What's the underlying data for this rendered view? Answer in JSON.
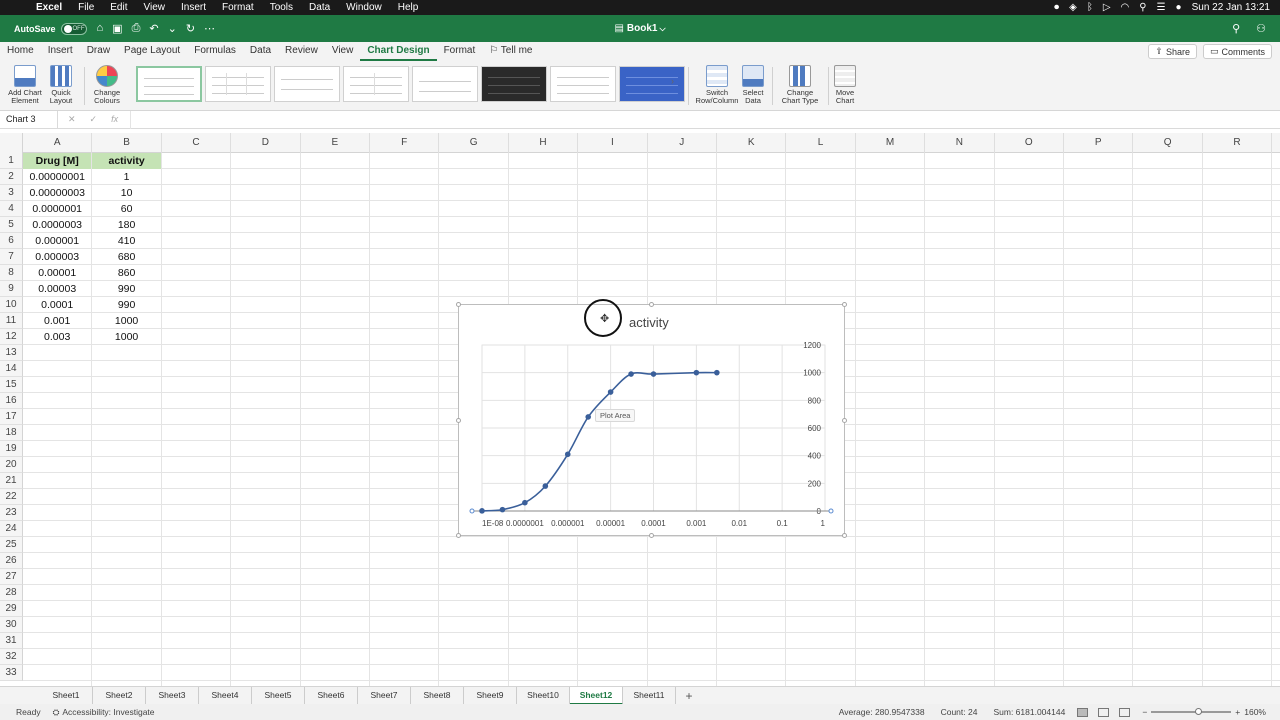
{
  "menubar": {
    "app": "Excel",
    "items": [
      "File",
      "Edit",
      "View",
      "Insert",
      "Format",
      "Tools",
      "Data",
      "Window",
      "Help"
    ],
    "clock": "Sun 22 Jan  13:21"
  },
  "titlebar": {
    "autosave": "AutoSave",
    "autosave_state": "OFF",
    "doc_title": "Book1",
    "doc_chevron": "⌵"
  },
  "ribbon_tabs": [
    "Home",
    "Insert",
    "Draw",
    "Page Layout",
    "Formulas",
    "Data",
    "Review",
    "View",
    "Chart Design",
    "Format",
    "Tell me"
  ],
  "ribbon_buttons": {
    "share": "Share",
    "comments": "Comments",
    "add_chart_element": [
      "Add Chart",
      "Element"
    ],
    "quick_layout": [
      "Quick",
      "Layout"
    ],
    "change_colours": [
      "Change",
      "Colours"
    ],
    "switch_row_col": [
      "Switch",
      "Row/Column"
    ],
    "select_data": [
      "Select",
      "Data"
    ],
    "change_chart_type": [
      "Change",
      "Chart Type"
    ],
    "move_chart": [
      "Move",
      "Chart"
    ]
  },
  "formula_bar": {
    "name_box": "Chart 3",
    "fx": "fx"
  },
  "columns": [
    "A",
    "B",
    "C",
    "D",
    "E",
    "F",
    "G",
    "H",
    "I",
    "J",
    "K",
    "L",
    "M",
    "N",
    "O",
    "P",
    "Q",
    "R"
  ],
  "rows": [
    "1",
    "2",
    "3",
    "4",
    "5",
    "6",
    "7",
    "8",
    "9",
    "10",
    "11",
    "12",
    "13",
    "14",
    "15",
    "16",
    "17",
    "18",
    "19",
    "20",
    "21",
    "22",
    "23",
    "24",
    "25",
    "26",
    "27",
    "28",
    "29",
    "30",
    "31",
    "32",
    "33"
  ],
  "sheet": {
    "headers": [
      "Drug [M]",
      "activity"
    ],
    "data": [
      [
        "0.00000001",
        "1"
      ],
      [
        "0.00000003",
        "10"
      ],
      [
        "0.0000001",
        "60"
      ],
      [
        "0.0000003",
        "180"
      ],
      [
        "0.000001",
        "410"
      ],
      [
        "0.000003",
        "680"
      ],
      [
        "0.00001",
        "860"
      ],
      [
        "0.00003",
        "990"
      ],
      [
        "0.0001",
        "990"
      ],
      [
        "0.001",
        "1000"
      ],
      [
        "0.003",
        "1000"
      ]
    ]
  },
  "chart_data": {
    "type": "scatter",
    "title": "activity",
    "x_scale": "log",
    "x": [
      1e-08,
      3e-08,
      1e-07,
      3e-07,
      1e-06,
      3e-06,
      1e-05,
      3e-05,
      0.0001,
      0.001,
      0.003
    ],
    "series": [
      {
        "values": [
          1,
          10,
          60,
          180,
          410,
          680,
          860,
          990,
          990,
          1000,
          1000
        ]
      }
    ],
    "x_ticks": [
      "1E-08",
      "0.0000001",
      "0.000001",
      "0.00001",
      "0.0001",
      "0.001",
      "0.01",
      "0.1",
      "1"
    ],
    "y_ticks": [
      "0",
      "200",
      "400",
      "600",
      "800",
      "1000",
      "1200"
    ],
    "xlim": [
      1e-08,
      1
    ],
    "ylim": [
      0,
      1200
    ],
    "y_axis_side": "right",
    "grid": true,
    "line_color": "#3a5f9a",
    "tooltip": "Plot Area"
  },
  "sheet_tabs": [
    "Sheet1",
    "Sheet2",
    "Sheet3",
    "Sheet4",
    "Sheet5",
    "Sheet6",
    "Sheet7",
    "Sheet8",
    "Sheet9",
    "Sheet10",
    "Sheet12",
    "Sheet11"
  ],
  "active_sheet": "Sheet12",
  "statusbar": {
    "ready": "Ready",
    "accessibility": "Accessibility: Investigate",
    "average": "Average: 280.9547338",
    "count": "Count: 24",
    "sum": "Sum: 6181.004144",
    "zoom": "160%"
  },
  "colors": {
    "excel_green": "#1f7a44",
    "header_fill": "#c5e3b5",
    "series": "#3a5f9a"
  }
}
